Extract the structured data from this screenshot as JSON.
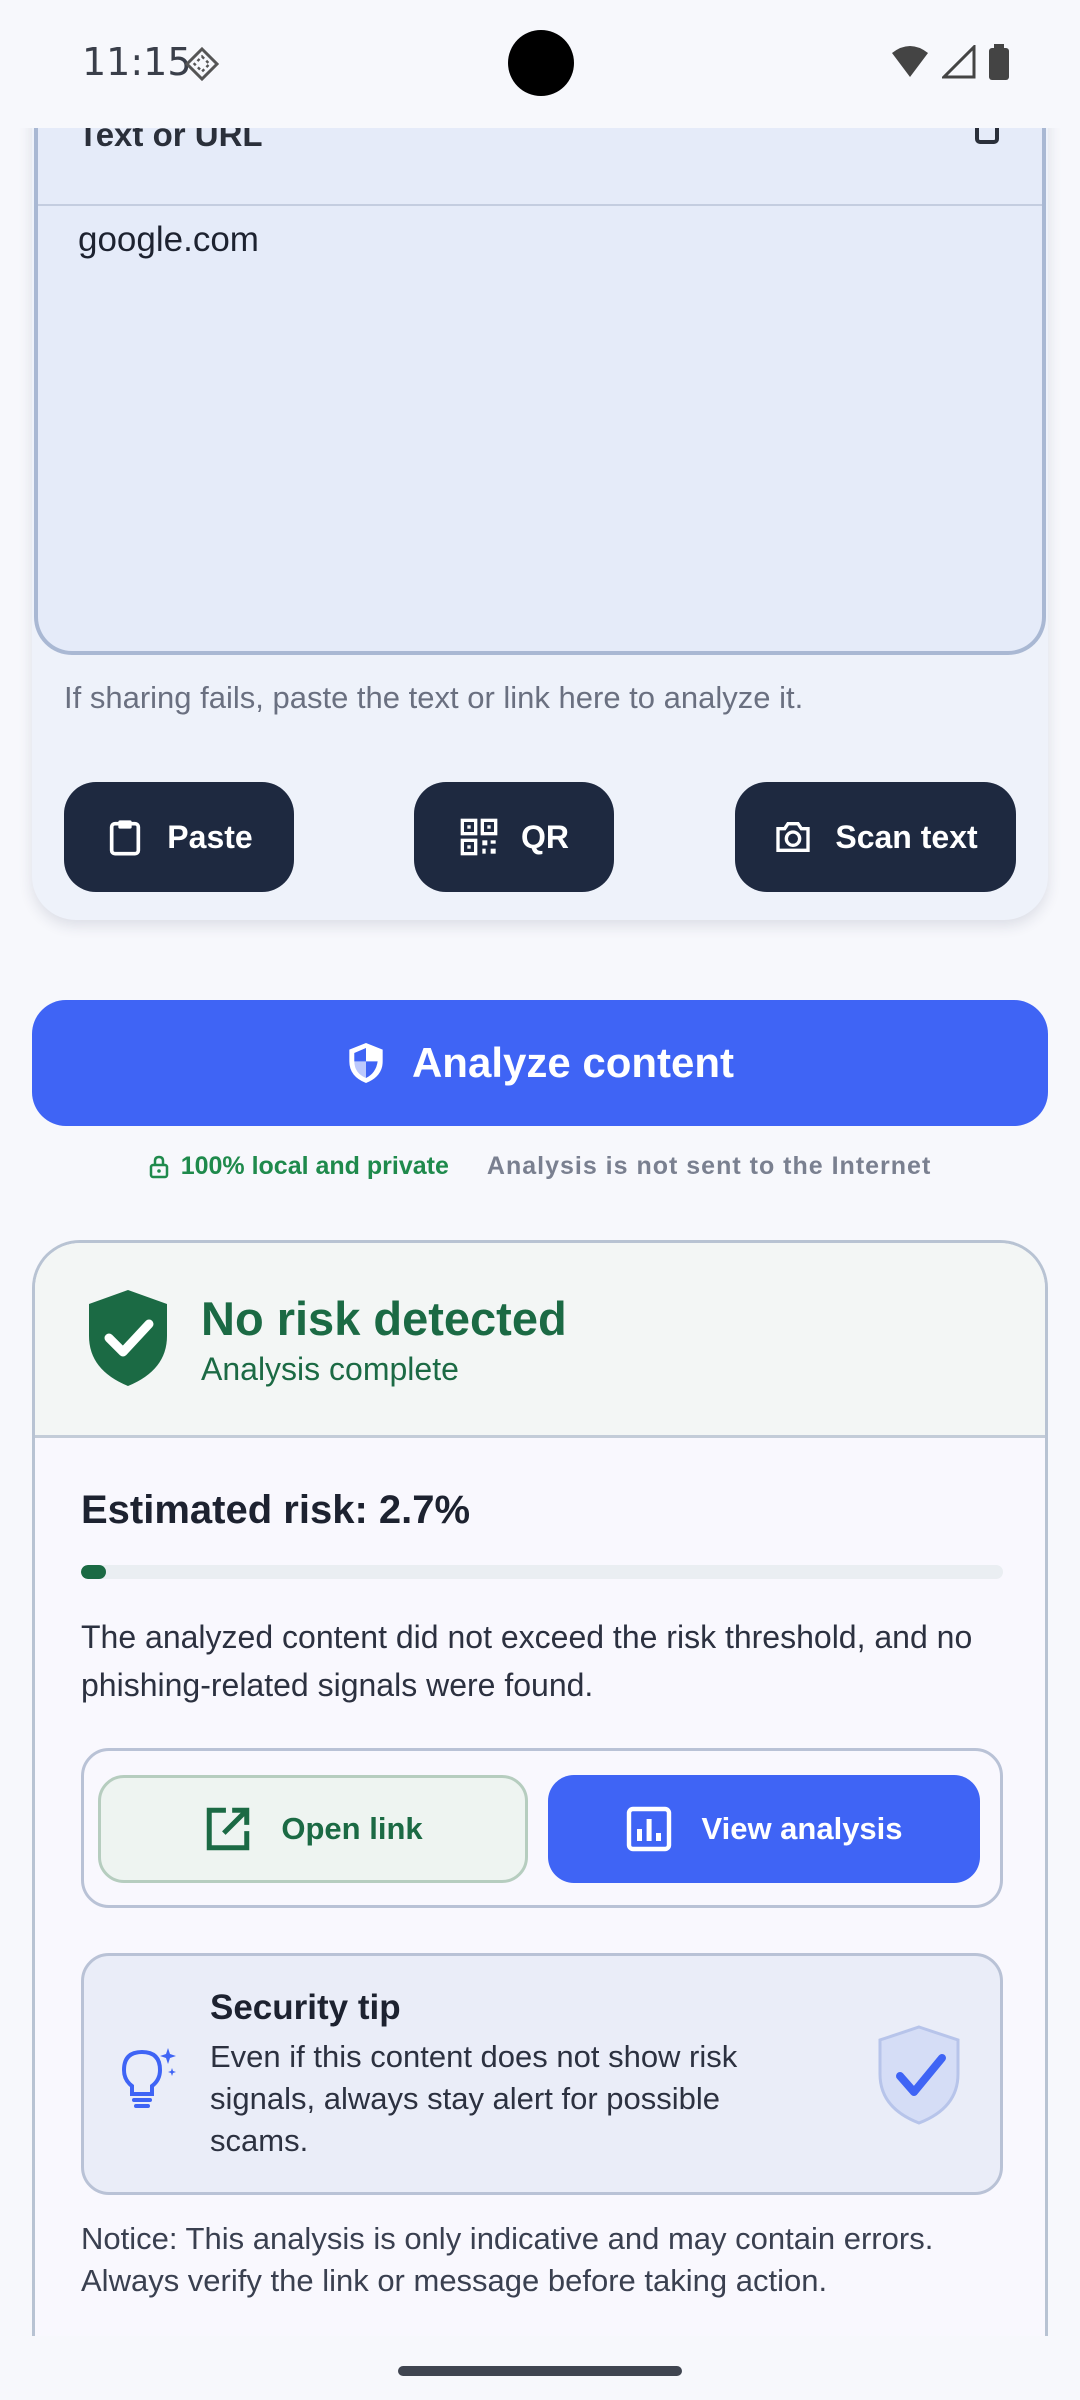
{
  "status_bar": {
    "time": "11:15"
  },
  "input_card": {
    "field_label": "Text or URL",
    "field_value": "google.com",
    "helper_text": "If sharing fails, paste the text or link here to analyze it.",
    "buttons": [
      {
        "label": "Paste",
        "icon": "clipboard-icon"
      },
      {
        "label": "QR",
        "icon": "qr-code-icon"
      },
      {
        "label": "Scan text",
        "icon": "camera-icon"
      }
    ]
  },
  "analyze": {
    "label": "Analyze content",
    "privacy_left": "100% local and private",
    "privacy_right": "Analysis is not sent to the Internet"
  },
  "result": {
    "title": "No risk detected",
    "subtitle": "Analysis complete",
    "risk_title": "Estimated risk: 2.7%",
    "risk_value": 2.7,
    "description": "The analyzed content did not exceed the risk threshold, and no phishing-related signals were found.",
    "open_link_label": "Open link",
    "view_analysis_label": "View analysis",
    "tip_title": "Security tip",
    "tip_text": "Even if this content does not show risk signals, always stay alert for possible scams.",
    "notice": "Notice: This analysis is only indicative and may contain errors. Always verify the link or message before taking action."
  },
  "colors": {
    "primary": "#3f64f5",
    "dark_button": "#1e2940",
    "safe_green": "#1b6a44"
  }
}
